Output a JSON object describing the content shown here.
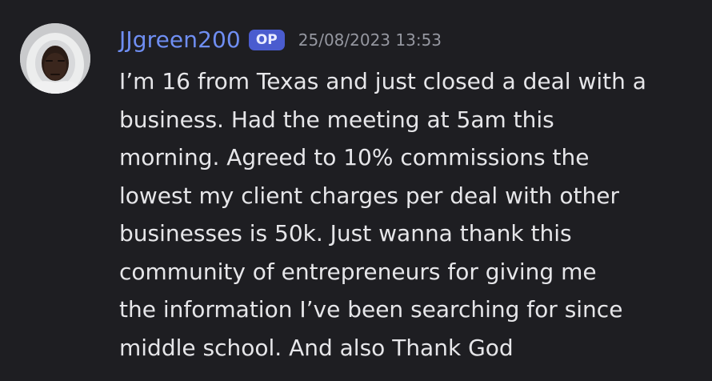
{
  "message": {
    "author": "JJgreen200",
    "badge": "OP",
    "timestamp": "25/08/2023 13:53",
    "avatar_icon": "user-avatar-hoodie",
    "text": "I’m 16 from Texas and just closed a deal with a\nbusiness. Had the meeting at 5am this\nmorning. Agreed to 10% commissions the\nlowest my client charges per deal with other\nbusinesses is 50k. Just wanna thank this\ncommunity of entrepreneurs for giving me\nthe information I’ve been searching for since\nmiddle school. And also Thank God"
  },
  "colors": {
    "background": "#1e1e22",
    "username": "#6f8ef2",
    "badge_bg": "#4a5ccf",
    "timestamp": "#9597a0",
    "text": "#e6e6e9"
  }
}
